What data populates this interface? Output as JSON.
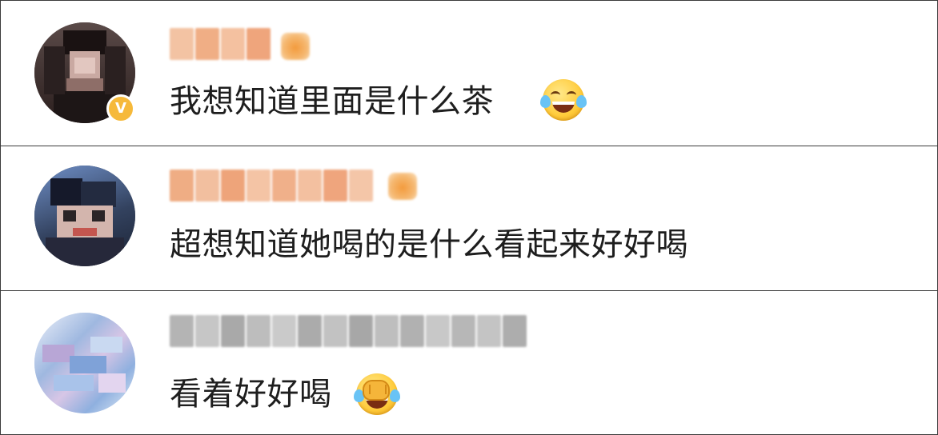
{
  "comments": [
    {
      "avatar_icon": "user-avatar-blurred",
      "verified": true,
      "verified_mark": "V",
      "member_icon": "member-crown-icon",
      "text": "我想知道里面是什么茶",
      "emoji": "face-with-tears-of-joy"
    },
    {
      "avatar_icon": "user-avatar-blurred",
      "verified": false,
      "member_icon": "member-crown-icon",
      "text": "超想知道她喝的是什么看起来好好喝",
      "emoji": null
    },
    {
      "avatar_icon": "user-avatar-blurred",
      "verified": false,
      "member_icon": null,
      "text": "看着好好喝",
      "emoji": "facepalm-face"
    }
  ],
  "colors": {
    "text": "#1e1e1e",
    "border": "#3a3a3a",
    "username_orange": "#f0a46a",
    "username_gray": "#a8a8a8",
    "verified_badge": "#f6b93a"
  }
}
